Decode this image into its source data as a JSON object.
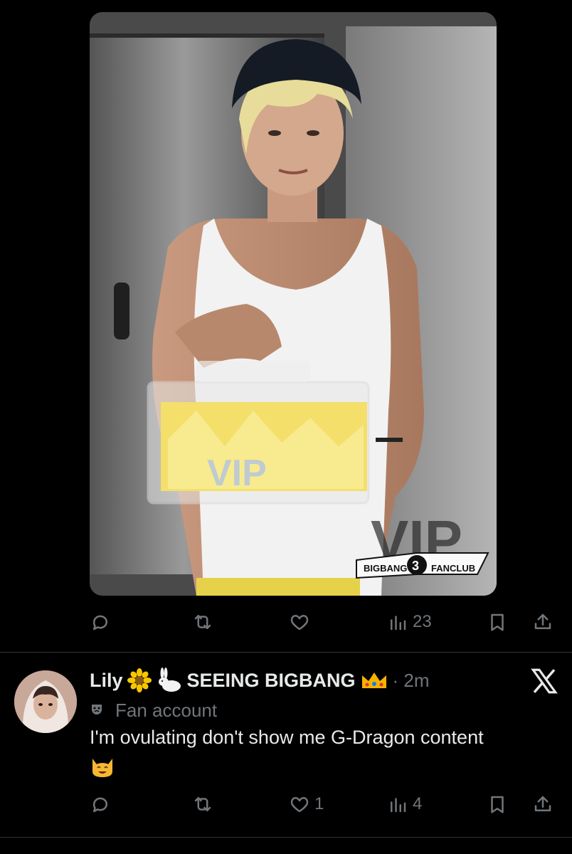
{
  "media": {
    "watermark": {
      "logo_text": "VIP",
      "left_text": "BIGBANG",
      "number": "3",
      "right_text": "FANCLUB"
    }
  },
  "tweet1_actions": {
    "reply_icon": "reply-icon",
    "retweet_icon": "retweet-icon",
    "like_icon": "heart-icon",
    "views_icon": "views-icon",
    "views_count": "23",
    "bookmark_icon": "bookmark-icon",
    "share_icon": "share-icon"
  },
  "tweet2": {
    "name": "Lily",
    "name_suffix": "SEEING BIGBANG",
    "separator_time": "· 2m",
    "badge_text": "Fan account",
    "text": "I'm ovulating don't show me G-Dragon content",
    "like_count": "1",
    "views_count": "4"
  },
  "colors": {
    "background": "#000000",
    "primary_text": "#e7e9ea",
    "secondary_text": "#71767b",
    "divider": "#2f3336"
  }
}
